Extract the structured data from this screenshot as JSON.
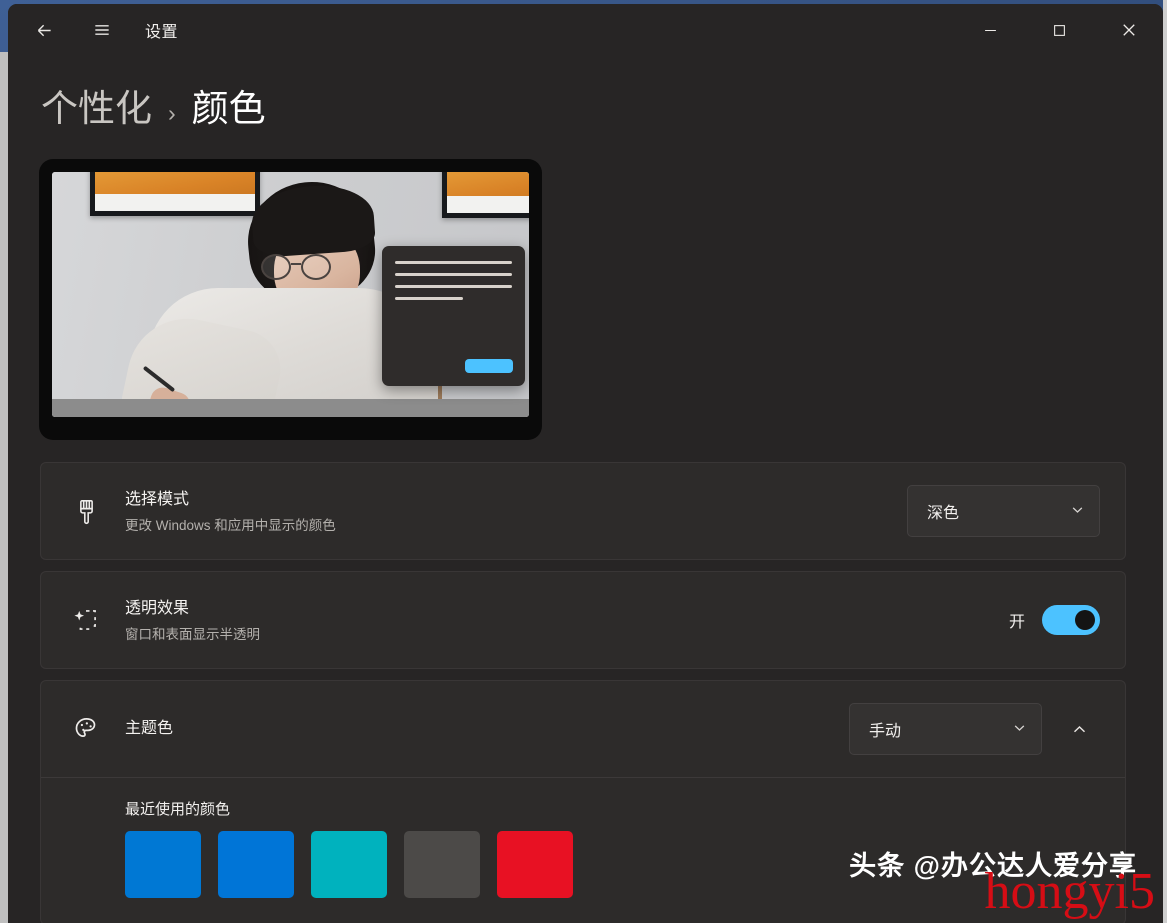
{
  "window": {
    "app_title": "设置",
    "back_icon": "arrow-left-icon",
    "menu_icon": "hamburger-menu-icon",
    "minimize_label": "—",
    "maximize_label": "□",
    "close_label": "✕"
  },
  "breadcrumb": {
    "parent": "个性化",
    "separator": "›",
    "current": "颜色"
  },
  "preview": {
    "name": "color-preview",
    "mock_window_lines": 4,
    "accent_button_color": "#4cc2ff"
  },
  "settings": [
    {
      "id": "choose-mode",
      "icon": "paintbrush-icon",
      "title": "选择模式",
      "subtitle": "更改 Windows 和应用中显示的颜色",
      "control": "dropdown",
      "value": "深色"
    },
    {
      "id": "transparency-effects",
      "icon": "sparkle-icon",
      "title": "透明效果",
      "subtitle": "窗口和表面显示半透明",
      "control": "toggle",
      "value": "开",
      "toggle_on": true
    },
    {
      "id": "accent-color",
      "icon": "palette-icon",
      "title": "主题色",
      "subtitle": "",
      "control": "dropdown",
      "value": "手动",
      "expanded": true,
      "expander_icon": "chevron-up-icon"
    }
  ],
  "recent_colors": {
    "label": "最近使用的颜色",
    "swatches": [
      {
        "name": "blue-1",
        "color": "#0078D4"
      },
      {
        "name": "blue-2",
        "color": "#0075D7"
      },
      {
        "name": "teal",
        "color": "#00B2BE"
      },
      {
        "name": "gray",
        "color": "#4C4A48"
      },
      {
        "name": "red",
        "color": "#E81123"
      }
    ]
  },
  "watermarks": {
    "white": "头条 @办公达人爱分享",
    "red": "hongyi5"
  }
}
